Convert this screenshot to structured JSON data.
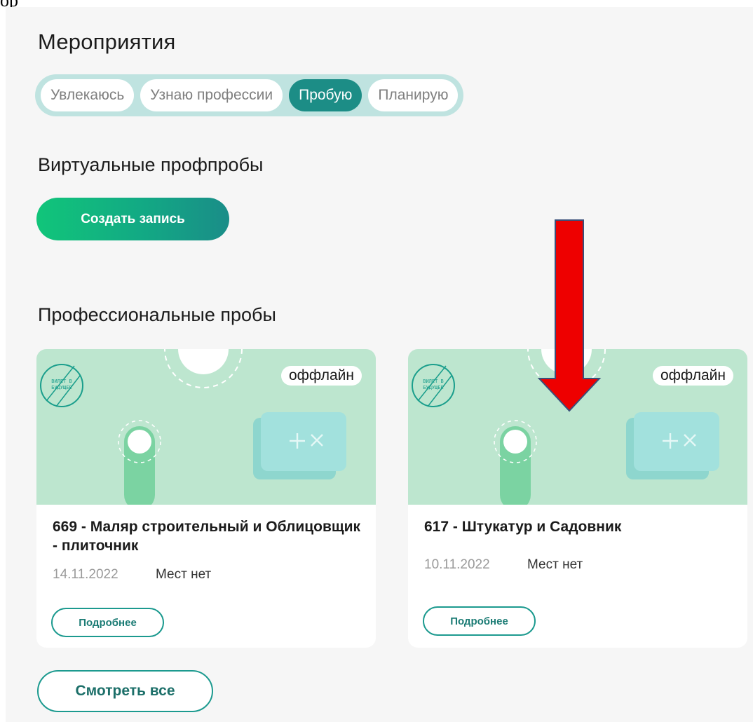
{
  "page": {
    "top_fragment": "ор",
    "events_title": "Мероприятия",
    "virtual_title": "Виртуальные профпробы",
    "professional_title": "Профессиональные пробы"
  },
  "tabs": [
    {
      "label": "Увлекаюсь",
      "active": false
    },
    {
      "label": "Узнаю профессии",
      "active": false
    },
    {
      "label": "Пробую",
      "active": true
    },
    {
      "label": "Планирую",
      "active": false
    }
  ],
  "create_button": {
    "label": "Создать запись"
  },
  "cards": [
    {
      "badge": "оффлайн",
      "logo_text": "ВИЛЕТ В БУДУЩЕЕ",
      "title": "669 - Маляр строительный и Облицовщик - плиточник",
      "date": "14.11.2022",
      "seats": "Мест нет",
      "button": "Подробнее"
    },
    {
      "badge": "оффлайн",
      "logo_text": "ВИЛЕТ В БУДУЩЕЕ",
      "title": "617 - Штукатур и Садовник",
      "date": "10.11.2022",
      "seats": "Мест нет",
      "button": "Подробнее"
    }
  ],
  "see_all_button": {
    "label": "Смотреть все"
  },
  "colors": {
    "accent": "#1c8d86",
    "tab_track": "#bfe3e0",
    "card_image_bg": "#bde6cf",
    "annotation_arrow": "#ee0000"
  },
  "icons": {
    "card_symbol": "plus-cross-icon",
    "annotation": "down-arrow-icon"
  }
}
